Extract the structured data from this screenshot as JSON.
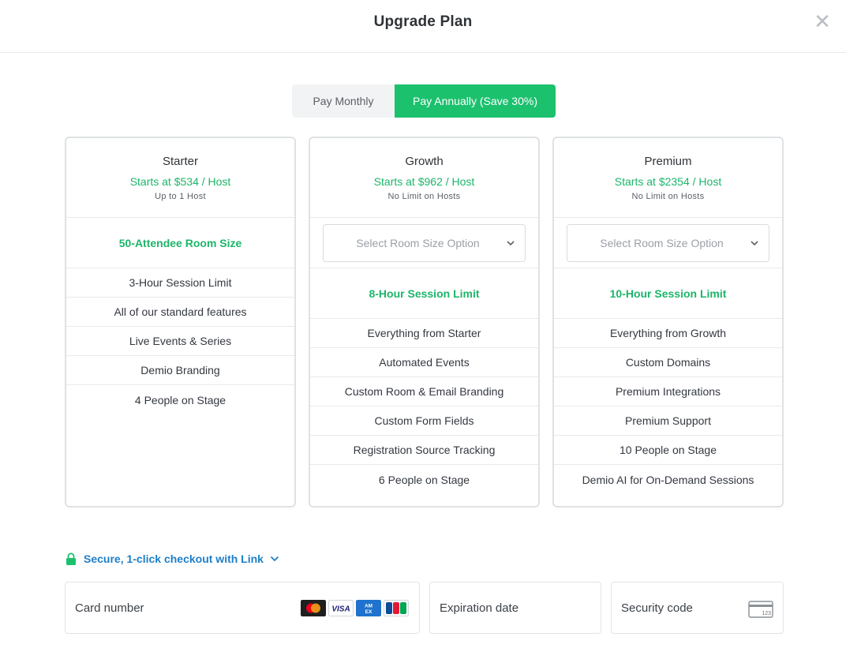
{
  "modal": {
    "title": "Upgrade Plan"
  },
  "billing_toggle": {
    "monthly_label": "Pay Monthly",
    "annual_label": "Pay Annually (Save 30%)",
    "selected": "annual"
  },
  "plans": [
    {
      "name": "Starter",
      "price": "Starts at $534 / Host",
      "hosts": "Up to 1 Host",
      "room_size": "50-Attendee Room Size",
      "features": [
        "3-Hour Session Limit",
        "All of our standard features",
        "Live Events & Series",
        "Demio Branding",
        "4 People on Stage"
      ]
    },
    {
      "name": "Growth",
      "price": "Starts at $962 / Host",
      "hosts": "No Limit on Hosts",
      "room_select_placeholder": "Select Room Size Option",
      "session_limit": "8-Hour Session Limit",
      "features": [
        "Everything from Starter",
        "Automated Events",
        "Custom Room & Email Branding",
        "Custom Form Fields",
        "Registration Source Tracking",
        "6 People on Stage"
      ]
    },
    {
      "name": "Premium",
      "price": "Starts at $2354 / Host",
      "hosts": "No Limit on Hosts",
      "room_select_placeholder": "Select Room Size Option",
      "session_limit": "10-Hour Session Limit",
      "features": [
        "Everything from Growth",
        "Custom Domains",
        "Premium Integrations",
        "Premium Support",
        "10 People on Stage",
        "Demio AI for On-Demand Sessions"
      ]
    }
  ],
  "checkout": {
    "secure_label": "Secure, 1-click checkout with Link",
    "card_number_label": "Card number",
    "expiration_label": "Expiration date",
    "security_code_label": "Security code",
    "card_brands": [
      "mastercard-icon",
      "visa-icon",
      "amex-icon",
      "jcb-icon"
    ],
    "cvc_hint": "123"
  },
  "colors": {
    "accent_green": "#1cc16e",
    "text_green": "#1cb56a",
    "link_blue": "#1d7fc7",
    "border": "#dfe2e5"
  }
}
